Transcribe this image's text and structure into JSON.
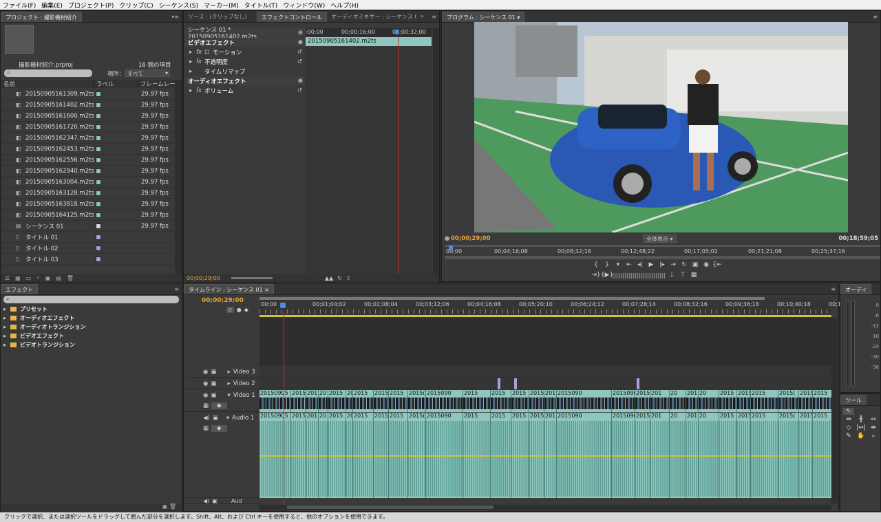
{
  "menu": [
    "ファイル(F)",
    "編集(E)",
    "プロジェクト(P)",
    "クリップ(C)",
    "シーケンス(S)",
    "マーカー(M)",
    "タイトル(T)",
    "ウィンドウ(W)",
    "ヘルプ(H)"
  ],
  "project": {
    "tab": "プロジェクト : 撮影機材紹介",
    "filename": "撮影機材紹介.prproj",
    "count": "16 個の項目",
    "location_label": "場所：",
    "location_value": "すべて",
    "col_name": "名前",
    "col_label": "ラベル",
    "col_fps": "フレームレート",
    "items": [
      {
        "name": "20150905161309.m2ts",
        "fps": "29.97 fps",
        "color": "#8fc7be",
        "kind": "clip"
      },
      {
        "name": "20150905161402.m2ts",
        "fps": "29.97 fps",
        "color": "#8fc7be",
        "kind": "clip"
      },
      {
        "name": "20150905161600.m2ts",
        "fps": "29.97 fps",
        "color": "#8fc7be",
        "kind": "clip"
      },
      {
        "name": "20150905161720.m2ts",
        "fps": "29.97 fps",
        "color": "#8fc7be",
        "kind": "clip"
      },
      {
        "name": "20150905162347.m2ts",
        "fps": "29.97 fps",
        "color": "#8fc7be",
        "kind": "clip"
      },
      {
        "name": "20150905162453.m2ts",
        "fps": "29.97 fps",
        "color": "#8fc7be",
        "kind": "clip"
      },
      {
        "name": "20150905162556.m2ts",
        "fps": "29.97 fps",
        "color": "#8fc7be",
        "kind": "clip"
      },
      {
        "name": "20150905162940.m2ts",
        "fps": "29.97 fps",
        "color": "#8fc7be",
        "kind": "clip"
      },
      {
        "name": "20150905163004.m2ts",
        "fps": "29.97 fps",
        "color": "#8fc7be",
        "kind": "clip"
      },
      {
        "name": "20150905163128.m2ts",
        "fps": "29.97 fps",
        "color": "#8fc7be",
        "kind": "clip"
      },
      {
        "name": "20150905163818.m2ts",
        "fps": "29.97 fps",
        "color": "#8fc7be",
        "kind": "clip"
      },
      {
        "name": "20150905164125.m2ts",
        "fps": "29.97 fps",
        "color": "#8fc7be",
        "kind": "clip"
      },
      {
        "name": "シーケンス 01",
        "fps": "29.97 fps",
        "color": "#d8d8d8",
        "kind": "seq"
      },
      {
        "name": "タイトル 01",
        "fps": "",
        "color": "#a8a0d8",
        "kind": "title"
      },
      {
        "name": "タイトル 02",
        "fps": "",
        "color": "#a8a0d8",
        "kind": "title"
      },
      {
        "name": "タイトル 03",
        "fps": "",
        "color": "#a8a0d8",
        "kind": "title"
      }
    ]
  },
  "source_tabs": {
    "source": "ソース : (クリップなし)",
    "effect_controls": "エフェクトコントロール",
    "mixer": "オーディオミキサー : シーケンス 01"
  },
  "effect_controls": {
    "header": "シーケンス 01 * 20150905161402.m2ts",
    "ruler": [
      ":00;00",
      "00;00;16;00",
      "00;00;32;00"
    ],
    "clip_label": "20150905161402.m2ts",
    "video_fx": "ビデオエフェクト",
    "items": [
      "モーション",
      "不透明度",
      "タイムリマップ"
    ],
    "audio_fx": "オーディオエフェクト",
    "audio_items": [
      "ボリューム"
    ],
    "timecode": "00;00;29;00"
  },
  "program": {
    "tab": "プログラム : シーケンス 01",
    "timecode": "00;00;29;00",
    "fit": "全体表示",
    "duration": "00;18;59;05",
    "ruler": [
      "00;00",
      "00;04;16;08",
      "00;08;32;16",
      "00;12;48;22",
      "00;17;05;02",
      "00;21;21;08",
      "00;25;37;16"
    ]
  },
  "effects": {
    "tab": "エフェクト",
    "folders": [
      "プリセット",
      "オーディオエフェクト",
      "オーディオトランジション",
      "ビデオエフェクト",
      "ビデオトランジション"
    ]
  },
  "timeline": {
    "tab": "タイムライン : シーケンス 01",
    "timecode": "00;00;29;00",
    "ruler": [
      "00;00",
      "00;01;04;02",
      "00;02;08;04",
      "00;03;12;06",
      "00;04;16;08",
      "00;05;20;10",
      "00;06;24;12",
      "00;07;28;14",
      "00;08;32;16",
      "00;09;36;18",
      "00;10;40;18",
      "00;11;4"
    ],
    "tracks": {
      "v3": "Video 3",
      "v2": "Video 2",
      "v1": "Video 1",
      "a1": "Audio 1",
      "aud": "Aud"
    },
    "clips": [
      "20150905",
      "2015",
      "201",
      "20",
      "2015",
      "20",
      "2015",
      "2015",
      "2015",
      "2015(",
      "2015090",
      "2015",
      "2015",
      "2015",
      "2015",
      "2015",
      "2015090"
    ]
  },
  "audio_meter": {
    "tab": "オーディ",
    "scale": [
      "0",
      "-6",
      "-12",
      "-18",
      "-24",
      "-30",
      "-36"
    ]
  },
  "tools": {
    "tab": "ツール"
  },
  "status": "クリックで選択、または選択ツールをドラッグして囲んだ部分を選択します。Shift、Alt、および Ctrl キーを使用すると、他のオプションを使用できます。"
}
